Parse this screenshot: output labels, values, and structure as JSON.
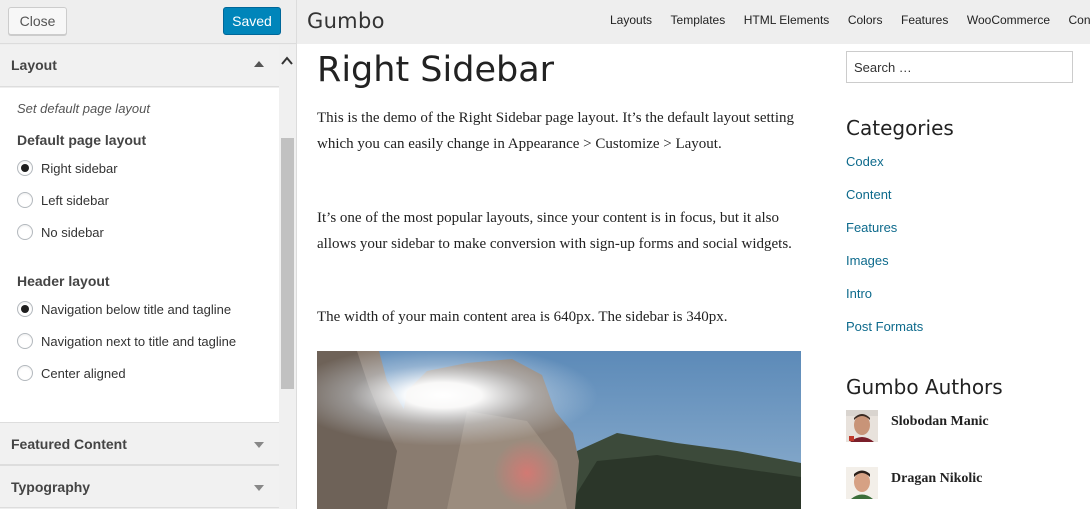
{
  "customizer": {
    "close_label": "Close",
    "saved_label": "Saved",
    "section_layout": {
      "title": "Layout",
      "hint": "Set default page layout",
      "default_layout": {
        "title": "Default page layout",
        "options": [
          "Right sidebar",
          "Left sidebar",
          "No sidebar"
        ],
        "selected": "Right sidebar"
      },
      "header_layout": {
        "title": "Header layout",
        "options": [
          "Navigation below title and tagline",
          "Navigation next to title and tagline",
          "Center aligned"
        ],
        "selected": "Navigation below title and tagline"
      }
    },
    "collapsed_sections": [
      "Featured Content",
      "Typography"
    ]
  },
  "site": {
    "title": "Gumbo",
    "nav": [
      "Layouts",
      "Templates",
      "HTML Elements",
      "Colors",
      "Features",
      "WooCommerce",
      "Contact"
    ]
  },
  "page": {
    "title": "Right Sidebar",
    "paragraphs": [
      "This is the demo of the Right Sidebar page layout. It’s the default layout setting which you can easily change in Appearance > Customize > Layout.",
      "It’s one of the most popular layouts, since your content is in focus, but it also allows your sidebar to make conversion with sign-up forms and social widgets.",
      "The width of your main content area is 640px. The sidebar is 340px."
    ]
  },
  "sidebar": {
    "search_placeholder": "Search …",
    "categories_title": "Categories",
    "categories": [
      "Codex",
      "Content",
      "Features",
      "Images",
      "Intro",
      "Post Formats"
    ],
    "authors_title": "Gumbo Authors",
    "authors": [
      "Slobodan Manic",
      "Dragan Nikolic"
    ]
  },
  "colors": {
    "accent": "#0085ba",
    "link": "#0d6a8c",
    "panel_bg": "#eeeeee"
  }
}
